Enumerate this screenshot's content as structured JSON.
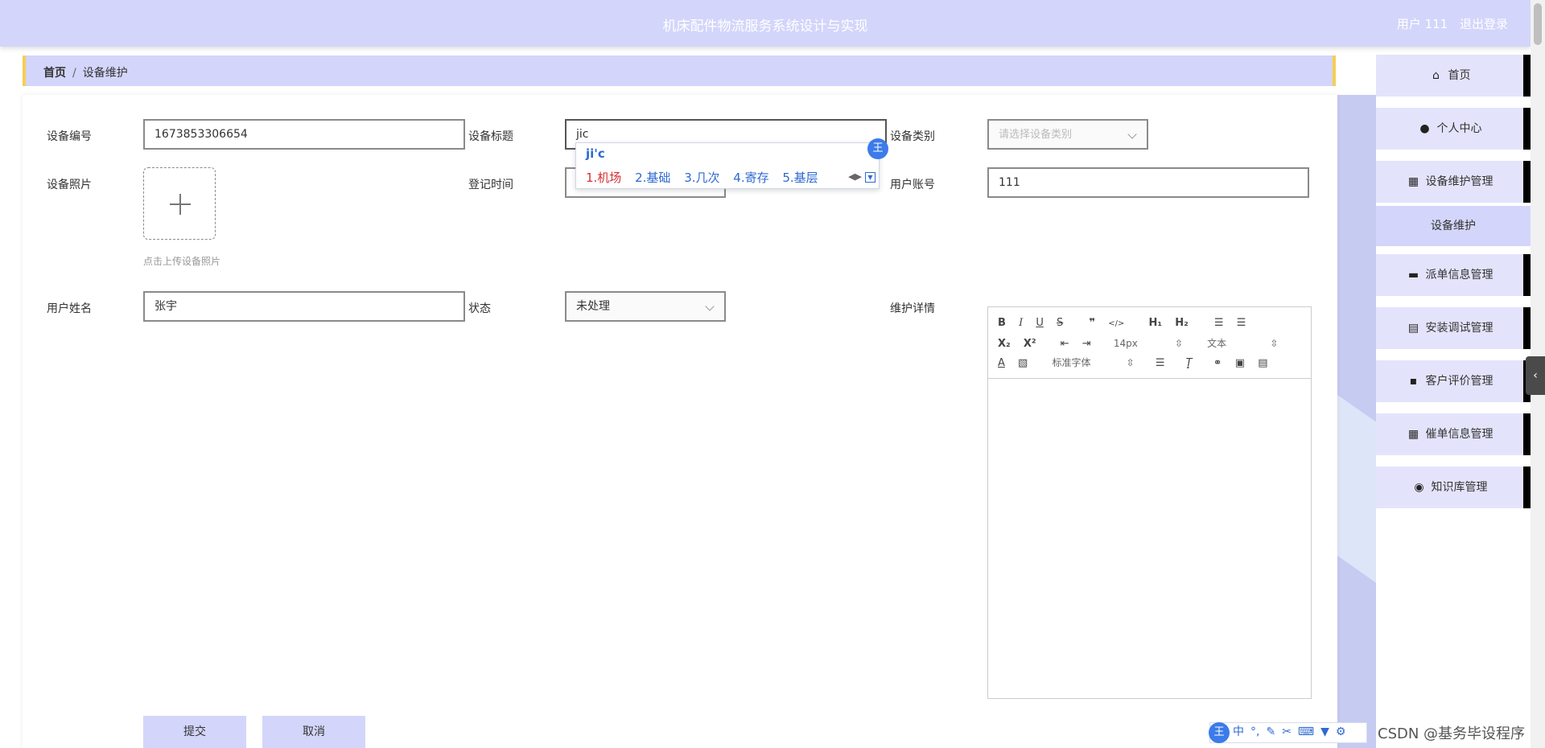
{
  "header": {
    "title": "机床配件物流服务系统设计与实现",
    "user": "用户 111",
    "logout": "退出登录"
  },
  "breadcrumb": {
    "home": "首页",
    "separator": "/",
    "current": "设备维护"
  },
  "form": {
    "device_no": {
      "label": "设备编号",
      "value": "1673853306654"
    },
    "device_title": {
      "label": "设备标题",
      "value": "jic"
    },
    "device_type": {
      "label": "设备类别",
      "placeholder": "请选择设备类别"
    },
    "device_photo": {
      "label": "设备照片",
      "tip": "点击上传设备照片"
    },
    "register_time": {
      "label": "登记时间",
      "value": ""
    },
    "user_account": {
      "label": "用户账号",
      "value": "111"
    },
    "user_name": {
      "label": "用户姓名",
      "value": "张宇"
    },
    "status": {
      "label": "状态",
      "value": "未处理"
    },
    "detail": {
      "label": "维护详情"
    },
    "submit": "提交",
    "cancel": "取消"
  },
  "editor": {
    "font_size": "14px",
    "block_type": "文本",
    "font_family": "标准字体"
  },
  "ime": {
    "composition": "ji'c",
    "candidates": [
      "1.机场",
      "2.基础",
      "3.几次",
      "4.寄存",
      "5.基层"
    ],
    "logo": "王"
  },
  "sidebar": {
    "items": [
      {
        "label": "首页",
        "icon": "home-icon"
      },
      {
        "label": "个人中心",
        "icon": "user-icon"
      },
      {
        "label": "设备维护管理",
        "icon": "grid-icon"
      },
      {
        "label": "设备维护",
        "sub": true
      },
      {
        "label": "派单信息管理",
        "icon": "monitor-icon"
      },
      {
        "label": "安装调试管理",
        "icon": "briefcase-icon"
      },
      {
        "label": "客户评价管理",
        "icon": "chat-icon"
      },
      {
        "label": "催单信息管理",
        "icon": "grid-icon"
      },
      {
        "label": "知识库管理",
        "icon": "bulb-icon"
      }
    ]
  },
  "ime_bar": {
    "mode": "中"
  },
  "watermark": "CSDN @基务毕设程序",
  "colors": {
    "header": "#d3d5fa",
    "accent": "#f5cf54",
    "nav": "#e3e4fb"
  }
}
